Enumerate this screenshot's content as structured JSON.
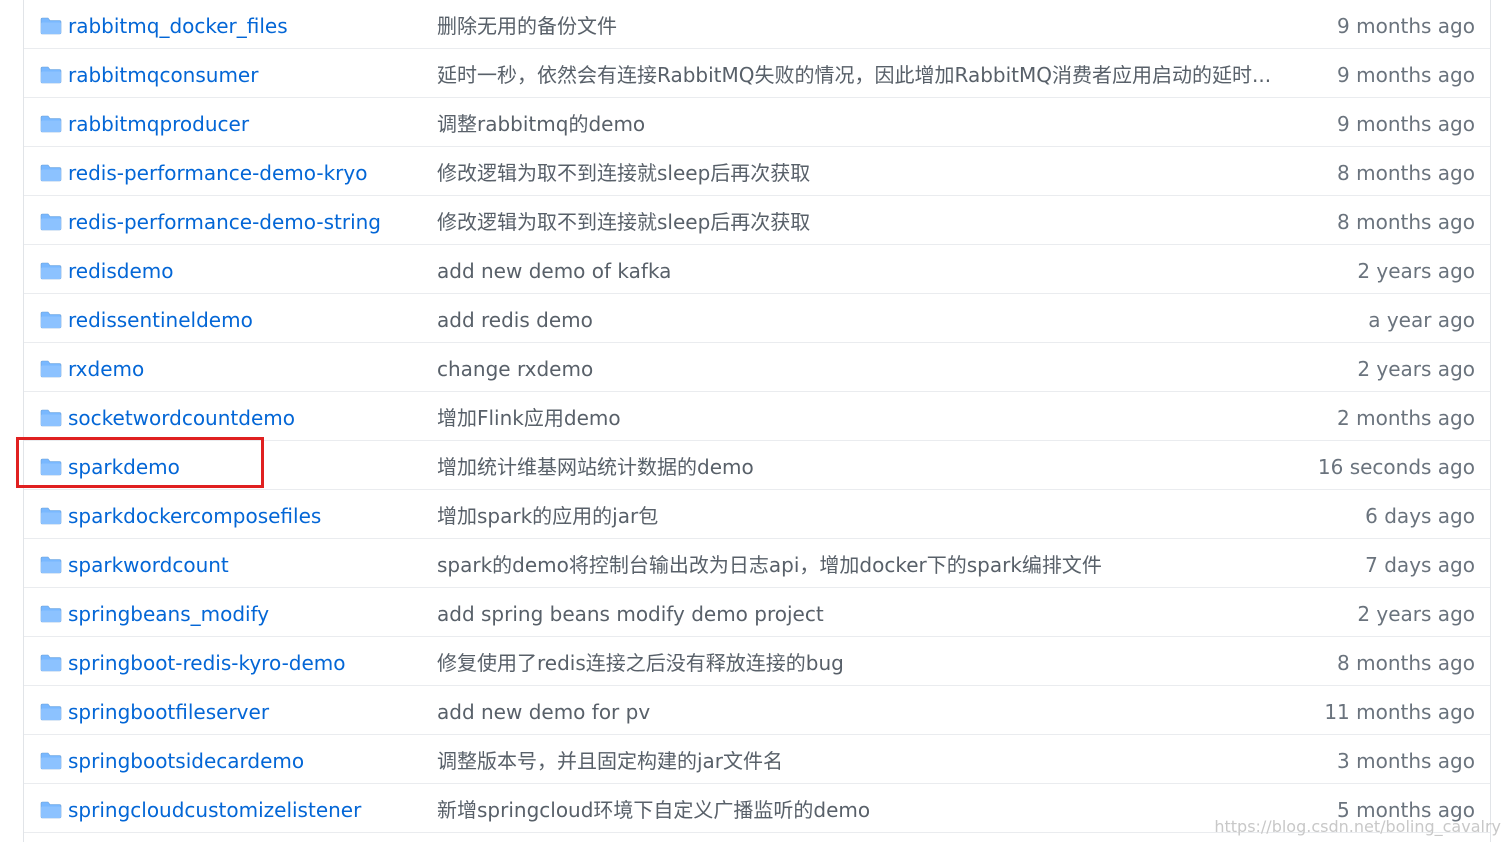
{
  "accent_color": "#0366d6",
  "highlight_color": "#e02020",
  "rows": [
    {
      "name": "rabbitmq_docker_files",
      "message": "删除无用的备份文件",
      "age": "9 months ago",
      "icon": "folder-icon"
    },
    {
      "name": "rabbitmqconsumer",
      "message": "延时一秒，依然会有连接RabbitMQ失败的情况，因此增加RabbitMQ消费者应用启动的延时...",
      "age": "9 months ago",
      "icon": "folder-icon"
    },
    {
      "name": "rabbitmqproducer",
      "message": "调整rabbitmq的demo",
      "age": "9 months ago",
      "icon": "folder-icon"
    },
    {
      "name": "redis-performance-demo-kryo",
      "message": "修改逻辑为取不到连接就sleep后再次获取",
      "age": "8 months ago",
      "icon": "folder-icon"
    },
    {
      "name": "redis-performance-demo-string",
      "message": "修改逻辑为取不到连接就sleep后再次获取",
      "age": "8 months ago",
      "icon": "folder-icon"
    },
    {
      "name": "redisdemo",
      "message": "add new demo of kafka",
      "age": "2 years ago",
      "icon": "folder-icon"
    },
    {
      "name": "redissentineldemo",
      "message": "add redis demo",
      "age": "a year ago",
      "icon": "folder-icon"
    },
    {
      "name": "rxdemo",
      "message": "change rxdemo",
      "age": "2 years ago",
      "icon": "folder-icon"
    },
    {
      "name": "socketwordcountdemo",
      "message": "增加Flink应用demo",
      "age": "2 months ago",
      "icon": "folder-icon"
    },
    {
      "name": "sparkdemo",
      "message": "增加统计维基网站统计数据的demo",
      "age": "16 seconds ago",
      "icon": "folder-icon",
      "highlighted": true
    },
    {
      "name": "sparkdockercomposefiles",
      "message": "增加spark的应用的jar包",
      "age": "6 days ago",
      "icon": "folder-icon"
    },
    {
      "name": "sparkwordcount",
      "message": "spark的demo将控制台输出改为日志api，增加docker下的spark编排文件",
      "age": "7 days ago",
      "icon": "folder-icon"
    },
    {
      "name": "springbeans_modify",
      "message": "add spring beans modify demo project",
      "age": "2 years ago",
      "icon": "folder-icon"
    },
    {
      "name": "springboot-redis-kyro-demo",
      "message": "修复使用了redis连接之后没有释放连接的bug",
      "age": "8 months ago",
      "icon": "folder-icon"
    },
    {
      "name": "springbootfileserver",
      "message": "add new demo for pv",
      "age": "11 months ago",
      "icon": "folder-icon"
    },
    {
      "name": "springbootsidecardemo",
      "message": "调整版本号，并且固定构建的jar文件名",
      "age": "3 months ago",
      "icon": "folder-icon"
    },
    {
      "name": "springcloudcustomizelistener",
      "message": "新增springcloud环境下自定义广播监听的demo",
      "age": "5 months ago",
      "icon": "folder-icon"
    }
  ],
  "watermark": "https://blog.csdn.net/boling_cavalry"
}
